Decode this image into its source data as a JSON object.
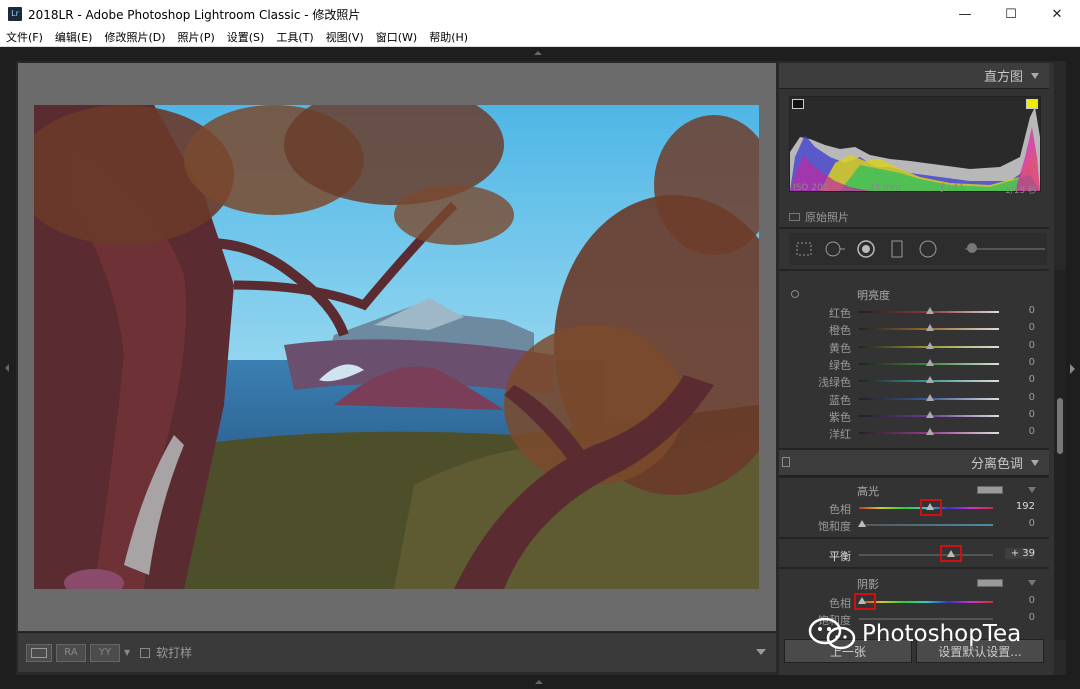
{
  "window": {
    "title": "2018LR - Adobe Photoshop Lightroom Classic - 修改照片",
    "app_icon": "Lr",
    "controls": {
      "minimize": "—",
      "maximize": "☐",
      "close": "✕"
    }
  },
  "menu": [
    "文件(F)",
    "编辑(E)",
    "修改照片(D)",
    "照片(P)",
    "设置(S)",
    "工具(T)",
    "视图(V)",
    "窗口(W)",
    "帮助(H)"
  ],
  "toolbar": {
    "view_label": "",
    "before_after_ra": "RA",
    "before_after_yy": "YY",
    "soft_proof": "软打样"
  },
  "histogram": {
    "title": "直方图",
    "iso": "ISO 200",
    "focal": "24 mm",
    "aperture": "ƒ / 11",
    "shutter": "1/13 秒",
    "original_photo": "原始照片"
  },
  "hsl": {
    "title": "明亮度",
    "rows": [
      {
        "label": "红色",
        "value": "0",
        "track": "#8a3a3a"
      },
      {
        "label": "橙色",
        "value": "0",
        "track": "#9a6a30"
      },
      {
        "label": "黄色",
        "value": "0",
        "track": "#9a9a30"
      },
      {
        "label": "绿色",
        "value": "0",
        "track": "#3a8a3a"
      },
      {
        "label": "浅绿色",
        "value": "0",
        "track": "#3a9a9a"
      },
      {
        "label": "蓝色",
        "value": "0",
        "track": "#3a5a9a"
      },
      {
        "label": "紫色",
        "value": "0",
        "track": "#6a3a9a"
      },
      {
        "label": "洋红",
        "value": "0",
        "track": "#9a3a8a"
      }
    ]
  },
  "split_toning": {
    "title": "分离色调",
    "highlights": {
      "title": "高光",
      "hue_label": "色相",
      "hue_value": "192",
      "hue_pos": 0.53,
      "sat_label": "饱和度",
      "sat_value": "0",
      "sat_pos": 0.02
    },
    "balance": {
      "label": "平衡",
      "value": "+ 39",
      "pos": 0.69
    },
    "shadows": {
      "title": "阴影",
      "hue_label": "色相",
      "hue_value": "0",
      "hue_pos": 0.02,
      "sat_label": "饱和度",
      "sat_value": "0"
    }
  },
  "buttons": {
    "previous": "上一张",
    "reset": "设置默认设置..."
  },
  "watermark": "PhotoshopTea"
}
